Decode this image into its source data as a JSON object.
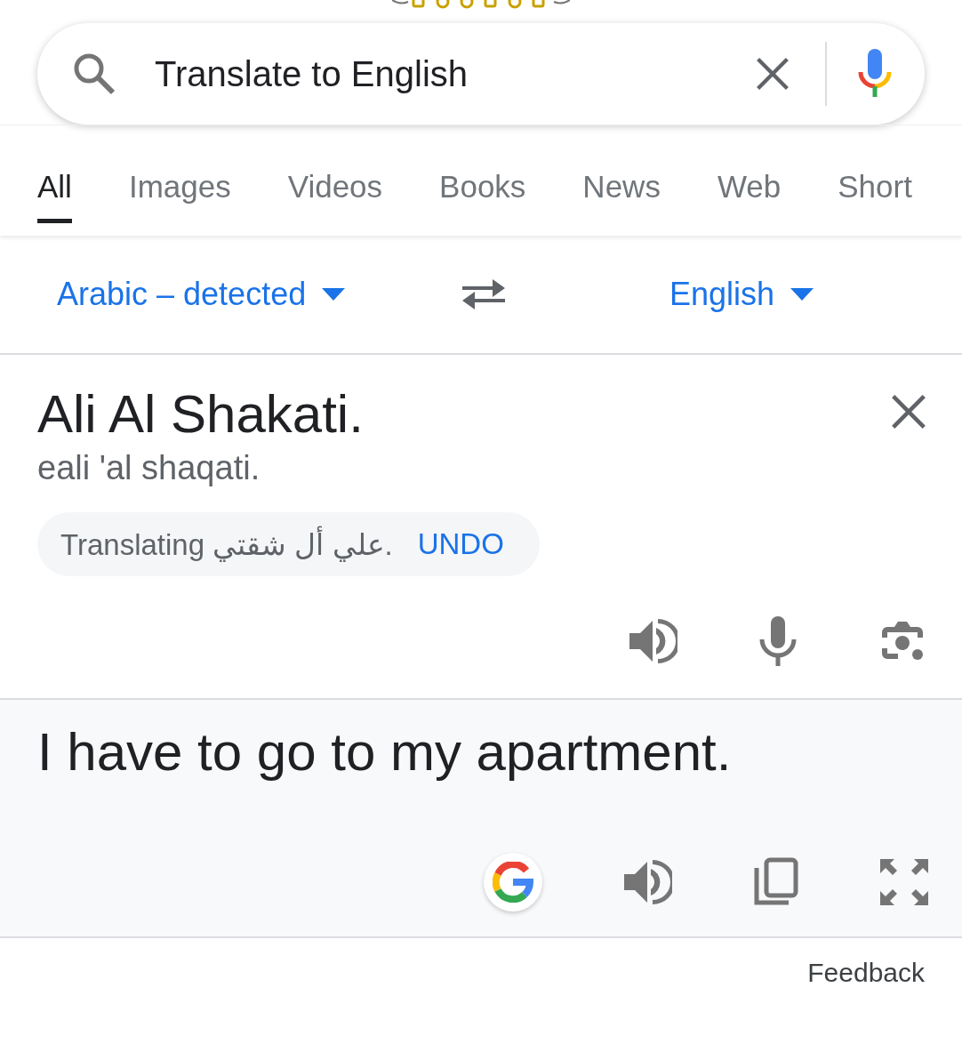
{
  "search": {
    "value": "Translate to English"
  },
  "tabs": [
    {
      "label": "All",
      "selected": true
    },
    {
      "label": "Images",
      "selected": false
    },
    {
      "label": "Videos",
      "selected": false
    },
    {
      "label": "Books",
      "selected": false
    },
    {
      "label": "News",
      "selected": false
    },
    {
      "label": "Web",
      "selected": false
    },
    {
      "label": "Short",
      "selected": false
    }
  ],
  "languages": {
    "source": "Arabic – detected",
    "target": "English"
  },
  "source": {
    "text": "Ali Al Shakati.",
    "romanization": "eali 'al shaqati.",
    "notice": "Translating علي أل شقتي.",
    "undo": "UNDO"
  },
  "result": {
    "text": "I have to go to my apartment."
  },
  "feedback": "Feedback"
}
